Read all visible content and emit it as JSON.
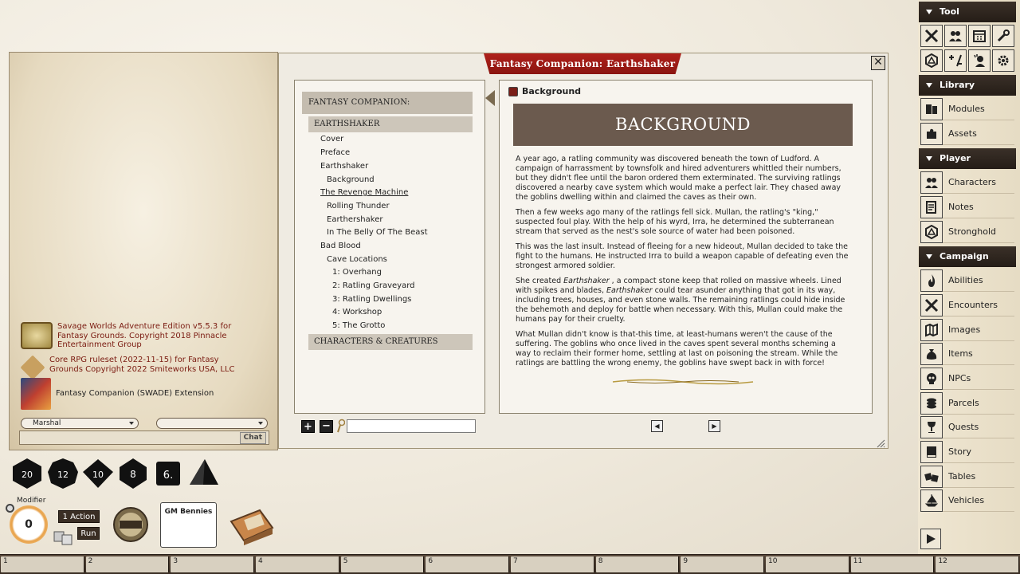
{
  "chat": {
    "entries": [
      {
        "text": "Savage Worlds Adventure Edition v5.5.3 for Fantasy Grounds. Copyright 2018 Pinnacle Entertainment Group"
      },
      {
        "text": "Core RPG ruleset (2022-11-15) for Fantasy Grounds Copyright 2022 Smiteworks USA, LLC"
      },
      {
        "text": "Fantasy Companion (SWADE) Extension"
      }
    ],
    "identity": "Marshal",
    "send_label": "Chat"
  },
  "book": {
    "title": "Fantasy Companion: Earthshaker",
    "toc_head": "FANTASY COMPANION: EARTHSHAKER",
    "toc_sub": "EARTHSHAKER",
    "toc_items": [
      "Cover",
      "Preface",
      "Earthshaker",
      "Background",
      "The Revenge Machine",
      "Rolling Thunder",
      "Earthershaker",
      "In The Belly Of The Beast",
      "Bad Blood",
      "Cave Locations",
      "1: Overhang",
      "2: Ratling Graveyard",
      "3: Ratling Dwellings",
      "4: Workshop",
      "5: The Grotto"
    ],
    "toc_chars": "CHARACTERS & CREATURES",
    "section_label": "Background",
    "section_banner": "BACKGROUND",
    "p1": "A year ago, a ratling community was discovered beneath the town of Ludford. A campaign of harrassment by townsfolk and hired adventurers whittled their numbers, but they didn't flee until the baron ordered them exterminated. The surviving ratlings discovered a nearby cave system which would make a perfect lair. They chased away the goblins dwelling within and claimed the caves as their own.",
    "p2": "Then a few weeks ago many of the ratlings fell sick. Mullan, the ratling's \"king,\" suspected foul play. With the help of his wyrd, Irra, he determined the subterranean stream that served as the nest's sole source of water had been poisoned.",
    "p3": "This was the last insult. Instead of fleeing for a new hideout, Mullan decided to take the fight to the humans. He instructed Irra to build a weapon capable of defeating even the strongest armored soldier.",
    "p4a": "She created ",
    "p4b": "Earthshaker",
    "p4c": " , a compact stone keep that rolled on massive wheels. Lined with spikes and blades, ",
    "p4d": "Earthshaker",
    "p4e": " could tear asunder anything that got in its way, including trees, houses, and even stone walls. The remaining ratlings could hide inside the behemoth and deploy for battle when necessary. With this, Mullan could make the humans pay for their cruelty.",
    "p5": "What Mullan didn't know is that-this time, at least-humans weren't the cause of the suffering. The goblins who once lived in the caves spent several months scheming a way to reclaim their former home, settling at last on poisoning the stream. While the ratlings are battling the wrong enemy, the goblins have swept back in with force!",
    "close_glyph": "✕",
    "plus_glyph": "+",
    "minus_glyph": "−",
    "prev_glyph": "◀",
    "next_glyph": "▶"
  },
  "sidebar": {
    "tool_head": "Tool",
    "library_head": "Library",
    "player_head": "Player",
    "campaign_head": "Campaign",
    "library": [
      "Modules",
      "Assets"
    ],
    "player": [
      "Characters",
      "Notes",
      "Stronghold"
    ],
    "campaign": [
      "Abilities",
      "Encounters",
      "Images",
      "Items",
      "NPCs",
      "Parcels",
      "Quests",
      "Story",
      "Tables",
      "Vehicles"
    ]
  },
  "dice": [
    "20",
    "12",
    "10",
    "8",
    "6."
  ],
  "modifier": {
    "label": "Modifier",
    "value": "0"
  },
  "actions": {
    "action_label": "1 Action",
    "run_label": "Run"
  },
  "bennies": {
    "label": "GM Bennies"
  },
  "hotkeys": [
    "1",
    "2",
    "3",
    "4",
    "5",
    "6",
    "7",
    "8",
    "9",
    "10",
    "11",
    "12"
  ]
}
